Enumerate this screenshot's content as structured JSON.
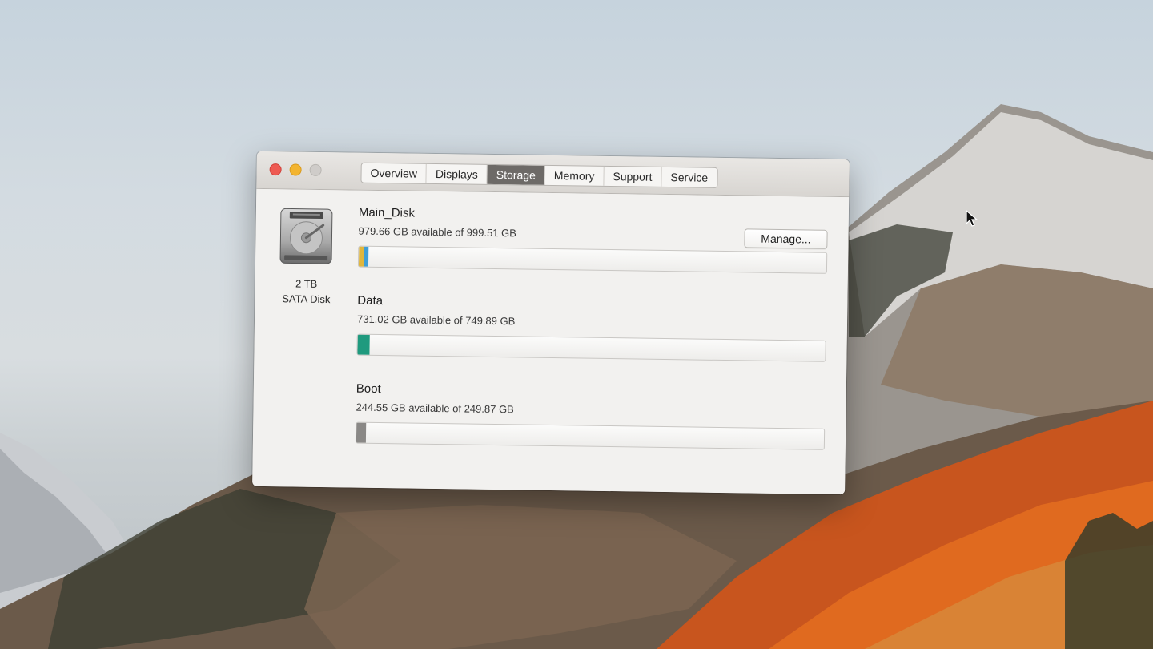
{
  "window": {
    "tabs": [
      {
        "label": "Overview",
        "active": false
      },
      {
        "label": "Displays",
        "active": false
      },
      {
        "label": "Storage",
        "active": true
      },
      {
        "label": "Memory",
        "active": false
      },
      {
        "label": "Support",
        "active": false
      },
      {
        "label": "Service",
        "active": false
      }
    ]
  },
  "disk": {
    "icon": "hard-disk-icon",
    "capacity": "2 TB",
    "type": "SATA Disk"
  },
  "manage_button": {
    "label": "Manage..."
  },
  "volumes": [
    {
      "name": "Main_Disk",
      "available_text": "979.66 GB available of 999.51 GB",
      "used_fraction": 0.02,
      "colors": [
        "#e0b63c",
        "#3f9ed6"
      ]
    },
    {
      "name": "Data",
      "available_text": "731.02 GB available of 749.89 GB",
      "used_fraction": 0.025,
      "colors": [
        "#1f9a7e"
      ]
    },
    {
      "name": "Boot",
      "available_text": "244.55 GB available of 249.87 GB",
      "used_fraction": 0.02,
      "colors": [
        "#8a8886"
      ]
    }
  ]
}
